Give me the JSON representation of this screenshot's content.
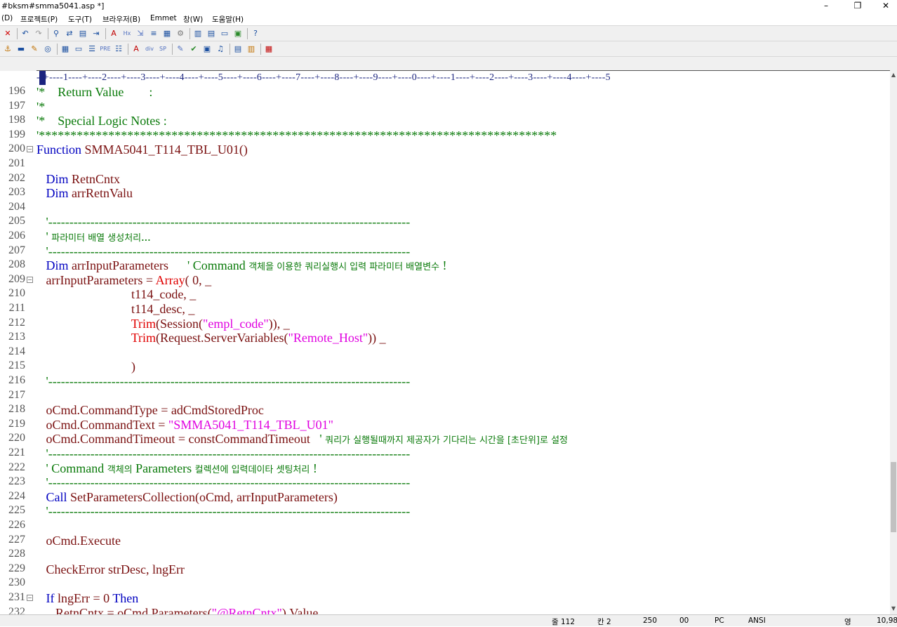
{
  "window": {
    "title": "#bksm#smma5041.asp *]",
    "minimize": "–",
    "restore": "❐",
    "close": "✕",
    "mdi_minimize": "_",
    "mdi_restore": "🗗",
    "mdi_close": "×"
  },
  "menu": [
    {
      "label": "(D)"
    },
    {
      "label": "프로젝트(P)"
    },
    {
      "label": "도구(T)"
    },
    {
      "label": "브라우저(B)"
    },
    {
      "label": "Emmet"
    },
    {
      "label": "창(W)"
    },
    {
      "label": "도움말(H)"
    }
  ],
  "toolbar1": [
    {
      "icon": "close-icon",
      "glyph": "✕",
      "color": "#d00000"
    },
    {
      "icon": "undo-icon",
      "glyph": "↶",
      "color": "#1a4fa0"
    },
    {
      "icon": "redo-icon",
      "glyph": "↷",
      "color": "#999999"
    },
    {
      "icon": "find-icon",
      "glyph": "⚲",
      "color": "#1a4fa0"
    },
    {
      "icon": "replace-icon",
      "glyph": "⇄",
      "color": "#1a4fa0"
    },
    {
      "icon": "find-in-files-icon",
      "glyph": "▤",
      "color": "#1a4fa0"
    },
    {
      "icon": "goto-line-icon",
      "glyph": "⇥",
      "color": "#1a4fa0"
    },
    {
      "icon": "font-size-icon",
      "glyph": "A",
      "color": "#c00000"
    },
    {
      "icon": "hex-icon",
      "glyph": "Hx",
      "color": "#5070c0"
    },
    {
      "icon": "word-wrap-icon",
      "glyph": "⇲",
      "color": "#5070c0"
    },
    {
      "icon": "line-numbers-icon",
      "glyph": "≡",
      "color": "#1a4fa0"
    },
    {
      "icon": "abc-icon",
      "glyph": "▦",
      "color": "#1a4fa0"
    },
    {
      "icon": "settings-icon",
      "glyph": "⚙",
      "color": "#777777"
    },
    {
      "icon": "panel-left-icon",
      "glyph": "▥",
      "color": "#1a4fa0"
    },
    {
      "icon": "panel-right-icon",
      "glyph": "▤",
      "color": "#1a4fa0"
    },
    {
      "icon": "panel-bottom-icon",
      "glyph": "▭",
      "color": "#1a4fa0"
    },
    {
      "icon": "window-icon",
      "glyph": "▣",
      "color": "#2a8a2a"
    },
    {
      "icon": "help-pointer-icon",
      "glyph": "?",
      "color": "#1a4fa0"
    }
  ],
  "toolbar2": [
    {
      "icon": "anchor-icon",
      "glyph": "⚓",
      "color": "#c07000"
    },
    {
      "icon": "hr-icon",
      "glyph": "▬",
      "color": "#1a4fa0"
    },
    {
      "icon": "edit-icon",
      "glyph": "✎",
      "color": "#c07000"
    },
    {
      "icon": "comment-icon",
      "glyph": "◎",
      "color": "#1a4fa0"
    },
    {
      "icon": "table-icon",
      "glyph": "▦",
      "color": "#1a4fa0"
    },
    {
      "icon": "form-icon",
      "glyph": "▭",
      "color": "#1a4fa0"
    },
    {
      "icon": "center-icon",
      "glyph": "☰",
      "color": "#1a4fa0"
    },
    {
      "icon": "pre-icon",
      "glyph": "PRE",
      "color": "#5070c0"
    },
    {
      "icon": "list-icon",
      "glyph": "☷",
      "color": "#1a4fa0"
    },
    {
      "icon": "label-icon",
      "glyph": "A",
      "color": "#c00000"
    },
    {
      "icon": "div-icon",
      "glyph": "div",
      "color": "#5070c0"
    },
    {
      "icon": "span-icon",
      "glyph": "SP",
      "color": "#5070c0"
    },
    {
      "icon": "notepad-icon",
      "glyph": "✎",
      "color": "#5070c0"
    },
    {
      "icon": "check-icon",
      "glyph": "✔",
      "color": "#2a8a2a"
    },
    {
      "icon": "image-icon",
      "glyph": "▣",
      "color": "#1a4fa0"
    },
    {
      "icon": "music-icon",
      "glyph": "♫",
      "color": "#1a4fa0"
    },
    {
      "icon": "frame-icon",
      "glyph": "▤",
      "color": "#1a4fa0"
    },
    {
      "icon": "frameset-icon",
      "glyph": "▥",
      "color": "#c07000"
    },
    {
      "icon": "palette-icon",
      "glyph": "▦",
      "color": "#c00000"
    }
  ],
  "ruler": {
    "text": "--+----1----+----2----+----3----+----4----+----5----+----6----+----7----+----8----+----9----+----0----+----1----+----2----+----3----+----4----+----5"
  },
  "lines": [
    {
      "n": "196",
      "fold": "",
      "tokens": [
        {
          "t": "'*    Return Value        :",
          "c": "cm"
        }
      ]
    },
    {
      "n": "197",
      "fold": "",
      "tokens": [
        {
          "t": "'*",
          "c": "cm"
        }
      ]
    },
    {
      "n": "198",
      "fold": "",
      "tokens": [
        {
          "t": "'*    Special Logic Notes :",
          "c": "cm"
        }
      ]
    },
    {
      "n": "199",
      "fold": "",
      "tokens": [
        {
          "t": "'**********************************************************************************",
          "c": "cm"
        }
      ]
    },
    {
      "n": "200",
      "fold": "⊟",
      "tokens": [
        {
          "t": "Function ",
          "c": "kw"
        },
        {
          "t": "SMMA5041_T114_TBL_U01()",
          "c": "id"
        }
      ]
    },
    {
      "n": "201",
      "fold": "",
      "tokens": []
    },
    {
      "n": "202",
      "fold": "",
      "tokens": [
        {
          "t": "   Dim ",
          "c": "kw"
        },
        {
          "t": "RetnCntx",
          "c": "id"
        }
      ]
    },
    {
      "n": "203",
      "fold": "",
      "tokens": [
        {
          "t": "   Dim ",
          "c": "kw"
        },
        {
          "t": "arrRetnValu",
          "c": "id"
        }
      ]
    },
    {
      "n": "204",
      "fold": "",
      "tokens": []
    },
    {
      "n": "205",
      "fold": "",
      "tokens": [
        {
          "t": "   '--------------------------------------------------------------------------------------",
          "c": "cm"
        }
      ]
    },
    {
      "n": "206",
      "fold": "",
      "tokens": [
        {
          "t": "   ' ",
          "c": "cm"
        },
        {
          "t": "파라미터 배열 생성처리",
          "c": "cm ko"
        },
        {
          "t": "...",
          "c": "cm"
        }
      ]
    },
    {
      "n": "207",
      "fold": "",
      "tokens": [
        {
          "t": "   '--------------------------------------------------------------------------------------",
          "c": "cm"
        }
      ]
    },
    {
      "n": "208",
      "fold": "",
      "tokens": [
        {
          "t": "   Dim ",
          "c": "kw"
        },
        {
          "t": "arrInputParameters      ",
          "c": "id"
        },
        {
          "t": "' Command ",
          "c": "cm"
        },
        {
          "t": "객체을 이용한 쿼리실행시 입력 파라미터 배열변수",
          "c": "cm ko"
        },
        {
          "t": " !",
          "c": "cm"
        }
      ]
    },
    {
      "n": "209",
      "fold": "⊟",
      "tokens": [
        {
          "t": "   arrInputParameters = ",
          "c": "id"
        },
        {
          "t": "Array",
          "c": "fn"
        },
        {
          "t": "( 0, _",
          "c": "id"
        }
      ]
    },
    {
      "n": "210",
      "fold": "",
      "tokens": [
        {
          "t": "                              t114_code, _",
          "c": "id"
        }
      ]
    },
    {
      "n": "211",
      "fold": "",
      "tokens": [
        {
          "t": "                              t114_desc, _",
          "c": "id"
        }
      ]
    },
    {
      "n": "212",
      "fold": "",
      "tokens": [
        {
          "t": "                              ",
          "c": "id"
        },
        {
          "t": "Trim",
          "c": "fn"
        },
        {
          "t": "(Session(",
          "c": "id"
        },
        {
          "t": "\"empl_code\"",
          "c": "st"
        },
        {
          "t": ")), _",
          "c": "id"
        }
      ]
    },
    {
      "n": "213",
      "fold": "",
      "tokens": [
        {
          "t": "                              ",
          "c": "id"
        },
        {
          "t": "Trim",
          "c": "fn"
        },
        {
          "t": "(Request.ServerVariables(",
          "c": "id"
        },
        {
          "t": "\"Remote_Host\"",
          "c": "st"
        },
        {
          "t": ")) _",
          "c": "id"
        }
      ]
    },
    {
      "n": "214",
      "fold": "",
      "tokens": []
    },
    {
      "n": "215",
      "fold": "",
      "tokens": [
        {
          "t": "                              )",
          "c": "id"
        }
      ]
    },
    {
      "n": "216",
      "fold": "",
      "tokens": [
        {
          "t": "   '--------------------------------------------------------------------------------------",
          "c": "cm"
        }
      ]
    },
    {
      "n": "217",
      "fold": "",
      "tokens": []
    },
    {
      "n": "218",
      "fold": "",
      "tokens": [
        {
          "t": "   oCmd.CommandType = adCmdStoredProc",
          "c": "id"
        }
      ]
    },
    {
      "n": "219",
      "fold": "",
      "tokens": [
        {
          "t": "   oCmd.CommandText = ",
          "c": "id"
        },
        {
          "t": "\"SMMA5041_T114_TBL_U01\"",
          "c": "st"
        }
      ]
    },
    {
      "n": "220",
      "fold": "",
      "tokens": [
        {
          "t": "   oCmd.CommandTimeout = constCommandTimeout   ",
          "c": "id"
        },
        {
          "t": "' ",
          "c": "cm"
        },
        {
          "t": "쿼리가 실행될때까지 제공자가 기다리는 시간을 [초단위]로 설정",
          "c": "cm ko"
        }
      ]
    },
    {
      "n": "221",
      "fold": "",
      "tokens": [
        {
          "t": "   '--------------------------------------------------------------------------------------",
          "c": "cm"
        }
      ]
    },
    {
      "n": "222",
      "fold": "",
      "tokens": [
        {
          "t": "   ' Command ",
          "c": "cm"
        },
        {
          "t": "객체의",
          "c": "cm ko"
        },
        {
          "t": " Parameters ",
          "c": "cm"
        },
        {
          "t": "컬렉션에 입력데이타 셋팅처리",
          "c": "cm ko"
        },
        {
          "t": " !",
          "c": "cm"
        }
      ]
    },
    {
      "n": "223",
      "fold": "",
      "tokens": [
        {
          "t": "   '--------------------------------------------------------------------------------------",
          "c": "cm"
        }
      ]
    },
    {
      "n": "224",
      "fold": "",
      "tokens": [
        {
          "t": "   Call ",
          "c": "kw"
        },
        {
          "t": "SetParametersCollection(oCmd, arrInputParameters)",
          "c": "id"
        }
      ]
    },
    {
      "n": "225",
      "fold": "",
      "tokens": [
        {
          "t": "   '--------------------------------------------------------------------------------------",
          "c": "cm"
        }
      ]
    },
    {
      "n": "226",
      "fold": "",
      "tokens": []
    },
    {
      "n": "227",
      "fold": "",
      "tokens": [
        {
          "t": "   oCmd.Execute",
          "c": "id"
        }
      ]
    },
    {
      "n": "228",
      "fold": "",
      "tokens": []
    },
    {
      "n": "229",
      "fold": "",
      "tokens": [
        {
          "t": "   CheckError strDesc, lngErr",
          "c": "id"
        }
      ]
    },
    {
      "n": "230",
      "fold": "",
      "tokens": []
    },
    {
      "n": "231",
      "fold": "⊟",
      "tokens": [
        {
          "t": "   If ",
          "c": "kw"
        },
        {
          "t": "lngErr = 0 ",
          "c": "id"
        },
        {
          "t": "Then",
          "c": "kw"
        }
      ]
    },
    {
      "n": "232",
      "fold": "",
      "tokens": [
        {
          "t": "      RetnCntx = oCmd.Parameters(",
          "c": "id"
        },
        {
          "t": "\"@RetnCntx\"",
          "c": "st"
        },
        {
          "t": ").Value",
          "c": "id"
        }
      ]
    }
  ],
  "status": {
    "line": "줄 112",
    "col": "칸 2",
    "chars": "250",
    "ovr": "00",
    "pc": "PC",
    "enc": "ANSI",
    "ime": "영",
    "size": "10,98"
  }
}
